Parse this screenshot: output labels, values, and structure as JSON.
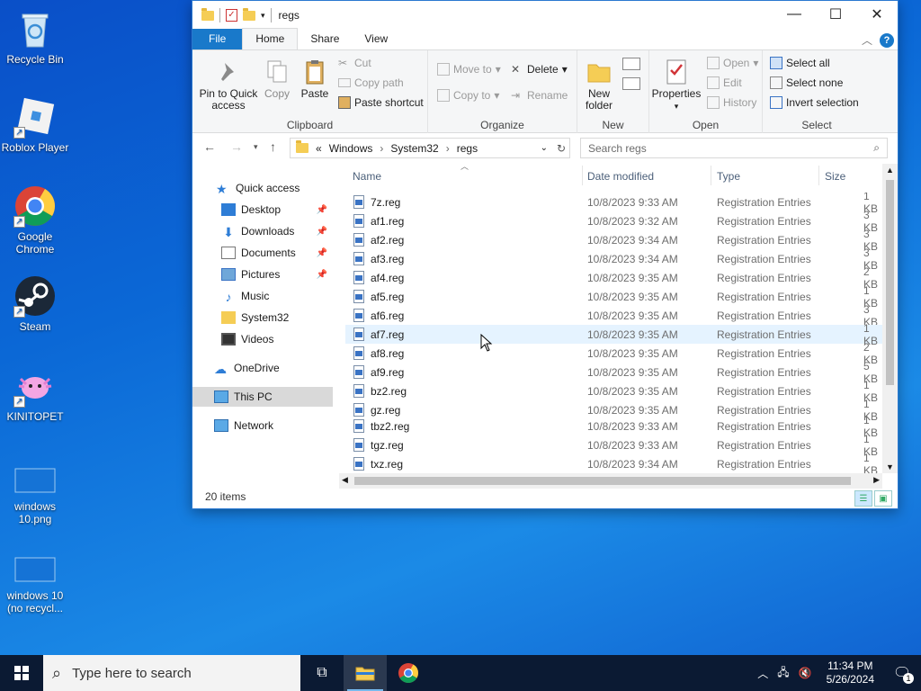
{
  "desktop": {
    "icons": [
      {
        "label": "Recycle Bin"
      },
      {
        "label": "Roblox Player"
      },
      {
        "label": "Google Chrome"
      },
      {
        "label": "Steam"
      },
      {
        "label": "KINITOPET"
      },
      {
        "label": "windows 10.png"
      },
      {
        "label": "windows 10 (no recycl..."
      }
    ]
  },
  "window": {
    "title": "regs",
    "tabs": {
      "file": "File",
      "home": "Home",
      "share": "Share",
      "view": "View"
    },
    "ribbon": {
      "clipboard": {
        "group": "Clipboard",
        "pin": "Pin to Quick access",
        "copy": "Copy",
        "paste": "Paste",
        "cut": "Cut",
        "copy_path": "Copy path",
        "paste_shortcut": "Paste shortcut"
      },
      "organize": {
        "group": "Organize",
        "move_to": "Move to",
        "copy_to": "Copy to",
        "delete": "Delete",
        "rename": "Rename"
      },
      "new": {
        "group": "New",
        "new_folder": "New folder"
      },
      "open": {
        "group": "Open",
        "properties": "Properties",
        "open": "Open",
        "edit": "Edit",
        "history": "History"
      },
      "select": {
        "group": "Select",
        "select_all": "Select all",
        "select_none": "Select none",
        "invert": "Invert selection"
      }
    },
    "address": {
      "chevron": "«",
      "crumbs": [
        "Windows",
        "System32",
        "regs"
      ],
      "search_placeholder": "Search regs"
    },
    "nav": {
      "quick_access": "Quick access",
      "items": [
        "Desktop",
        "Downloads",
        "Documents",
        "Pictures",
        "Music",
        "System32",
        "Videos"
      ],
      "onedrive": "OneDrive",
      "this_pc": "This PC",
      "network": "Network"
    },
    "columns": {
      "name": "Name",
      "date": "Date modified",
      "type": "Type",
      "size": "Size"
    },
    "files": [
      {
        "name": "7z.reg",
        "date": "10/8/2023 9:33 AM",
        "type": "Registration Entries",
        "size": "1 KB"
      },
      {
        "name": "af1.reg",
        "date": "10/8/2023 9:32 AM",
        "type": "Registration Entries",
        "size": "3 KB"
      },
      {
        "name": "af2.reg",
        "date": "10/8/2023 9:34 AM",
        "type": "Registration Entries",
        "size": "3 KB"
      },
      {
        "name": "af3.reg",
        "date": "10/8/2023 9:34 AM",
        "type": "Registration Entries",
        "size": "3 KB"
      },
      {
        "name": "af4.reg",
        "date": "10/8/2023 9:35 AM",
        "type": "Registration Entries",
        "size": "2 KB"
      },
      {
        "name": "af5.reg",
        "date": "10/8/2023 9:35 AM",
        "type": "Registration Entries",
        "size": "1 KB"
      },
      {
        "name": "af6.reg",
        "date": "10/8/2023 9:35 AM",
        "type": "Registration Entries",
        "size": "3 KB"
      },
      {
        "name": "af7.reg",
        "date": "10/8/2023 9:35 AM",
        "type": "Registration Entries",
        "size": "1 KB"
      },
      {
        "name": "af8.reg",
        "date": "10/8/2023 9:35 AM",
        "type": "Registration Entries",
        "size": "2 KB"
      },
      {
        "name": "af9.reg",
        "date": "10/8/2023 9:35 AM",
        "type": "Registration Entries",
        "size": "5 KB"
      },
      {
        "name": "bz2.reg",
        "date": "10/8/2023 9:35 AM",
        "type": "Registration Entries",
        "size": "1 KB"
      },
      {
        "name": "gz.reg",
        "date": "10/8/2023 9:35 AM",
        "type": "Registration Entries",
        "size": "1 KB"
      },
      {
        "name": "tbz2.reg",
        "date": "10/8/2023 9:33 AM",
        "type": "Registration Entries",
        "size": "1 KB"
      },
      {
        "name": "tgz.reg",
        "date": "10/8/2023 9:33 AM",
        "type": "Registration Entries",
        "size": "1 KB"
      },
      {
        "name": "txz.reg",
        "date": "10/8/2023 9:34 AM",
        "type": "Registration Entries",
        "size": "1 KB"
      }
    ],
    "status": "20 items"
  },
  "taskbar": {
    "search_placeholder": "Type here to search",
    "time": "11:34 PM",
    "date": "5/26/2024",
    "notification_count": "1"
  }
}
